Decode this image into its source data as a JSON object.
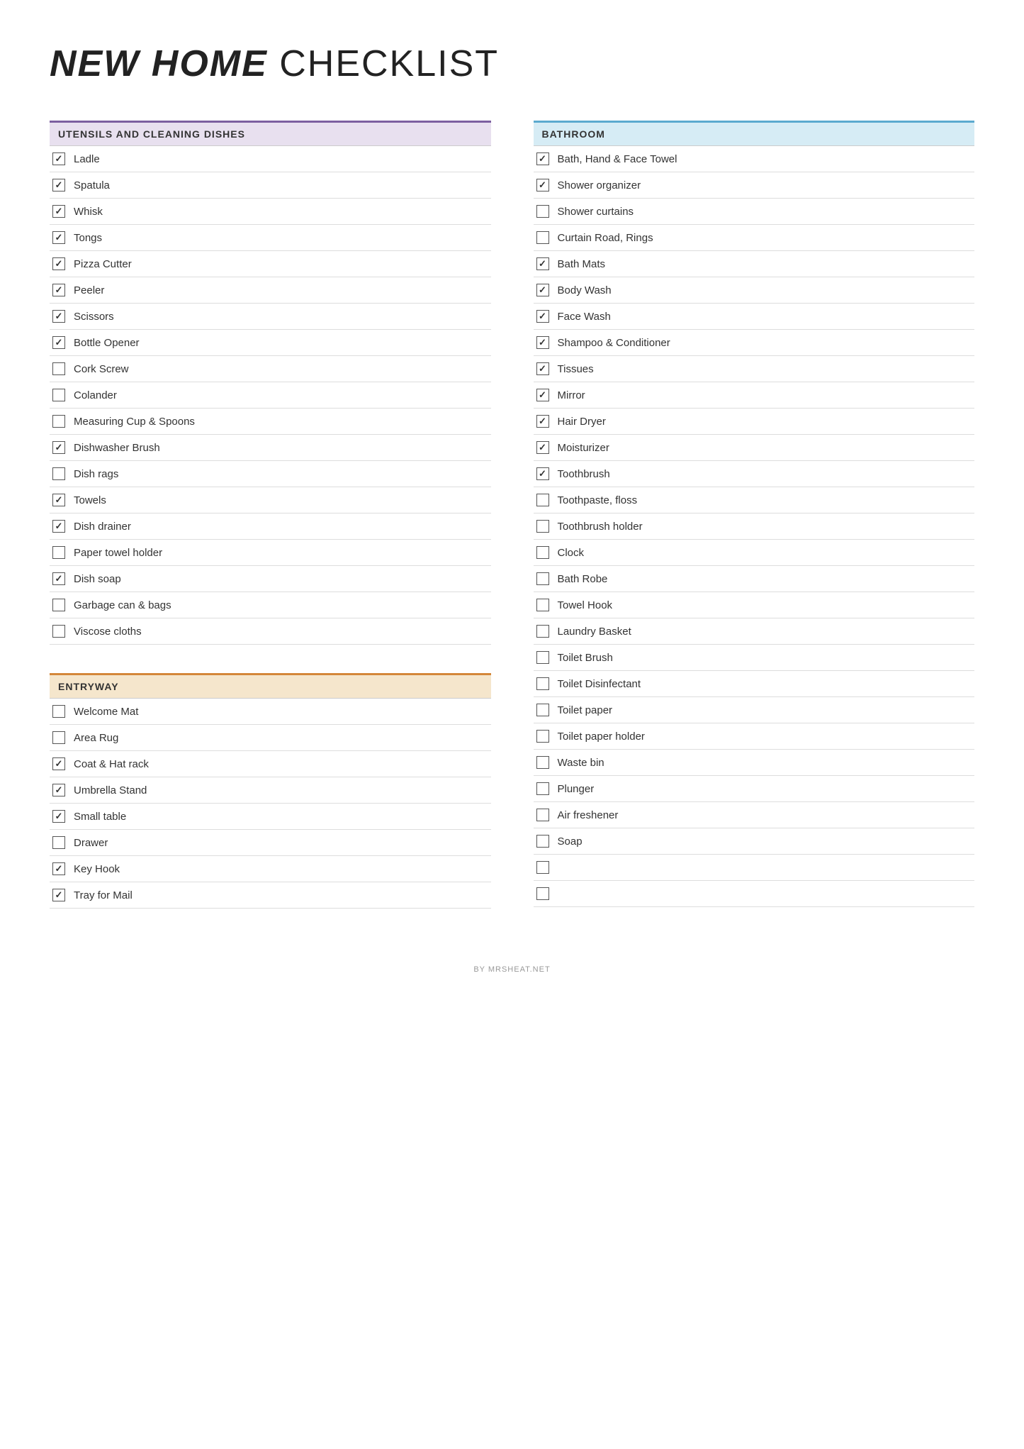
{
  "title": {
    "bold": "NEW HOME",
    "light": " CHECKLIST"
  },
  "left_column": [
    {
      "id": "utensils",
      "header": "UTENSILS AND CLEANING DISHES",
      "color": "purple",
      "items": [
        {
          "label": "Ladle",
          "checked": true
        },
        {
          "label": "Spatula",
          "checked": true
        },
        {
          "label": "Whisk",
          "checked": true
        },
        {
          "label": "Tongs",
          "checked": true
        },
        {
          "label": "Pizza Cutter",
          "checked": true
        },
        {
          "label": "Peeler",
          "checked": true
        },
        {
          "label": "Scissors",
          "checked": true
        },
        {
          "label": "Bottle Opener",
          "checked": true
        },
        {
          "label": "Cork Screw",
          "checked": false
        },
        {
          "label": "Colander",
          "checked": false
        },
        {
          "label": "Measuring Cup & Spoons",
          "checked": false
        },
        {
          "label": "Dishwasher Brush",
          "checked": true
        },
        {
          "label": "Dish rags",
          "checked": false
        },
        {
          "label": "Towels",
          "checked": true
        },
        {
          "label": "Dish drainer",
          "checked": true
        },
        {
          "label": "Paper towel holder",
          "checked": false
        },
        {
          "label": "Dish soap",
          "checked": true
        },
        {
          "label": "Garbage can & bags",
          "checked": false
        },
        {
          "label": "Viscose cloths",
          "checked": false
        }
      ]
    },
    {
      "id": "entryway",
      "header": "ENTRYWAY",
      "color": "orange",
      "items": [
        {
          "label": "Welcome Mat",
          "checked": false
        },
        {
          "label": "Area Rug",
          "checked": false
        },
        {
          "label": "Coat & Hat rack",
          "checked": true
        },
        {
          "label": "Umbrella Stand",
          "checked": true
        },
        {
          "label": "Small table",
          "checked": true
        },
        {
          "label": "Drawer",
          "checked": false
        },
        {
          "label": "Key Hook",
          "checked": true
        },
        {
          "label": "Tray for Mail",
          "checked": true
        }
      ]
    }
  ],
  "right_column": [
    {
      "id": "bathroom",
      "header": "BATHROOM",
      "color": "blue",
      "items": [
        {
          "label": "Bath, Hand & Face Towel",
          "checked": true
        },
        {
          "label": "Shower organizer",
          "checked": true
        },
        {
          "label": "Shower curtains",
          "checked": false
        },
        {
          "label": "Curtain Road, Rings",
          "checked": false
        },
        {
          "label": "Bath Mats",
          "checked": true
        },
        {
          "label": "Body Wash",
          "checked": true
        },
        {
          "label": "Face Wash",
          "checked": true
        },
        {
          "label": "Shampoo & Conditioner",
          "checked": true
        },
        {
          "label": "Tissues",
          "checked": true
        },
        {
          "label": "Mirror",
          "checked": true
        },
        {
          "label": "Hair Dryer",
          "checked": true
        },
        {
          "label": "Moisturizer",
          "checked": true
        },
        {
          "label": "Toothbrush",
          "checked": true
        },
        {
          "label": "Toothpaste, floss",
          "checked": false
        },
        {
          "label": "Toothbrush holder",
          "checked": false
        },
        {
          "label": "Clock",
          "checked": false
        },
        {
          "label": "Bath Robe",
          "checked": false
        },
        {
          "label": "Towel Hook",
          "checked": false
        },
        {
          "label": "Laundry Basket",
          "checked": false
        },
        {
          "label": "Toilet Brush",
          "checked": false
        },
        {
          "label": "Toilet Disinfectant",
          "checked": false
        },
        {
          "label": "Toilet paper",
          "checked": false
        },
        {
          "label": "Toilet paper holder",
          "checked": false
        },
        {
          "label": "Waste bin",
          "checked": false
        },
        {
          "label": "Plunger",
          "checked": false
        },
        {
          "label": "Air freshener",
          "checked": false
        },
        {
          "label": "Soap",
          "checked": false
        },
        {
          "label": "",
          "checked": false
        },
        {
          "label": "",
          "checked": false
        }
      ]
    }
  ],
  "footer": "BY MRSHEAT.NET"
}
